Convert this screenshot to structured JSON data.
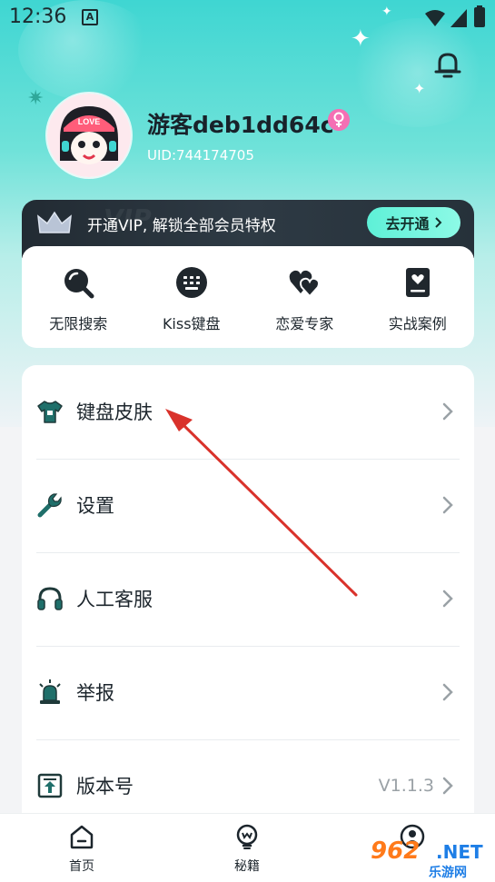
{
  "status_bar": {
    "time": "12:36",
    "notification_badge": "A"
  },
  "profile": {
    "username": "游客deb1dd64c",
    "uid": "UID:744174705",
    "avatar_badge": "LOVE"
  },
  "vip_banner": {
    "text": "开通VIP, 解锁全部会员特权",
    "button_label": "去开通",
    "watermark": "VIP"
  },
  "features": [
    {
      "label": "无限搜索",
      "icon": "search-icon"
    },
    {
      "label": "Kiss键盘",
      "icon": "keyboard-icon"
    },
    {
      "label": "恋爱专家",
      "icon": "hearts-icon"
    },
    {
      "label": "实战案例",
      "icon": "casebook-icon"
    }
  ],
  "menu": [
    {
      "label": "键盘皮肤",
      "icon": "tshirt-icon",
      "value": ""
    },
    {
      "label": "设置",
      "icon": "wrench-icon",
      "value": ""
    },
    {
      "label": "人工客服",
      "icon": "headset-icon",
      "value": ""
    },
    {
      "label": "举报",
      "icon": "siren-icon",
      "value": ""
    },
    {
      "label": "版本号",
      "icon": "version-icon",
      "value": "V1.1.3"
    }
  ],
  "tabs": [
    {
      "label": "首页",
      "icon": "home-icon"
    },
    {
      "label": "秘籍",
      "icon": "tips-icon"
    },
    {
      "label": "",
      "icon": "profile-icon"
    }
  ],
  "watermark": {
    "number": "962",
    "net": ".NET",
    "cn": "乐游网"
  },
  "colors": {
    "accent": "#3fd6d2",
    "vip_button": "#5ef0d7",
    "vip_bg": "#222b33",
    "female_badge": "#f46fb4",
    "arrow": "#d9322b"
  }
}
